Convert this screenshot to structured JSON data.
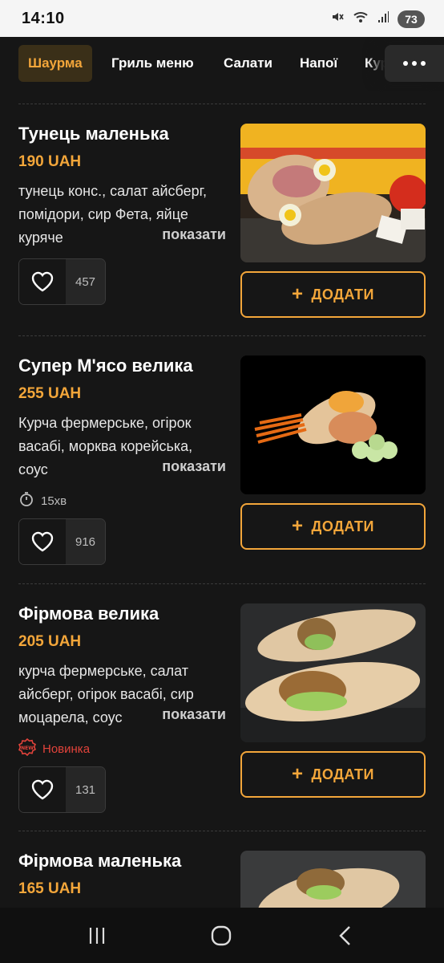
{
  "status": {
    "time": "14:10",
    "battery": "73",
    "icons": [
      "mute-icon",
      "wifi-icon",
      "signal-icon",
      "battery-icon"
    ]
  },
  "tabs": [
    {
      "label": "Шаурма",
      "active": true
    },
    {
      "label": "Гриль меню",
      "active": false
    },
    {
      "label": "Салати",
      "active": false
    },
    {
      "label": "Напої",
      "active": false
    },
    {
      "label": "Кур",
      "active": false
    }
  ],
  "colors": {
    "accent": "#f3a63a",
    "background": "#161616",
    "new_badge": "#e2433b"
  },
  "products": [
    {
      "title": "Тунець маленька",
      "price": "190 UAH",
      "description": "тунець конс., салат айсберг, помідори, сир Фета, яйце куряче",
      "show_more": "показати",
      "likes": "457",
      "add_label": "ДОДАТИ"
    },
    {
      "title": "Супер М'ясо велика",
      "price": "255 UAH",
      "description": "Курча фермерське, огірок васабі, морква корейська, соус",
      "show_more": "показати",
      "time": "15хв",
      "likes": "916",
      "add_label": "ДОДАТИ"
    },
    {
      "title": "Фірмова велика",
      "price": "205 UAH",
      "description": "курча фермерське, салат айсберг, огірок васабі, сир моцарела, соус",
      "show_more": "показати",
      "badge": "Новинка",
      "likes": "131",
      "add_label": "ДОДАТИ"
    },
    {
      "title": "Фірмова маленька",
      "price": "165 UAH"
    }
  ],
  "nav": [
    "recent-apps-icon",
    "home-icon",
    "back-icon"
  ]
}
